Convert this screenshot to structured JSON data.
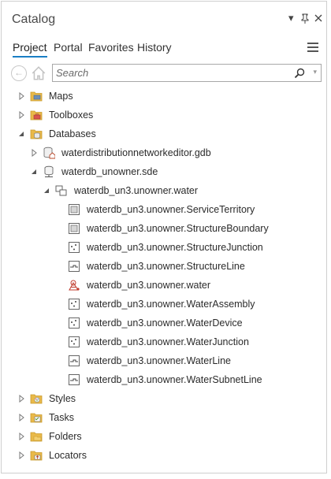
{
  "pane": {
    "title": "Catalog",
    "controls": {
      "options": "▾",
      "pin": "📌",
      "close": "✕"
    }
  },
  "tabs": [
    {
      "label": "Project",
      "active": true
    },
    {
      "label": "Portal",
      "active": false
    },
    {
      "label": "Favorites",
      "active": false
    },
    {
      "label": "History",
      "active": false
    }
  ],
  "search": {
    "placeholder": "Search",
    "value": ""
  },
  "tree": [
    {
      "label": "Maps",
      "icon": "maps-folder-icon",
      "expanded": false
    },
    {
      "label": "Toolboxes",
      "icon": "toolboxes-folder-icon",
      "expanded": false
    },
    {
      "label": "Databases",
      "icon": "databases-folder-icon",
      "expanded": true
    },
    {
      "label": "waterdistributionnetworkeditor.gdb",
      "icon": "geodatabase-home-icon",
      "expanded": false
    },
    {
      "label": "waterdb_unowner.sde",
      "icon": "database-connection-icon",
      "expanded": true
    },
    {
      "label": "waterdb_un3.unowner.water",
      "icon": "feature-dataset-icon",
      "expanded": true
    },
    {
      "label": "waterdb_un3.unowner.ServiceTerritory",
      "icon": "polygon-feature-class-icon"
    },
    {
      "label": "waterdb_un3.unowner.StructureBoundary",
      "icon": "polygon-feature-class-icon"
    },
    {
      "label": "waterdb_un3.unowner.StructureJunction",
      "icon": "point-feature-class-icon"
    },
    {
      "label": "waterdb_un3.unowner.StructureLine",
      "icon": "line-feature-class-icon"
    },
    {
      "label": "waterdb_un3.unowner.water",
      "icon": "utility-network-icon"
    },
    {
      "label": "waterdb_un3.unowner.WaterAssembly",
      "icon": "point-feature-class-icon"
    },
    {
      "label": "waterdb_un3.unowner.WaterDevice",
      "icon": "point-feature-class-icon"
    },
    {
      "label": "waterdb_un3.unowner.WaterJunction",
      "icon": "point-feature-class-icon"
    },
    {
      "label": "waterdb_un3.unowner.WaterLine",
      "icon": "line-feature-class-icon"
    },
    {
      "label": "waterdb_un3.unowner.WaterSubnetLine",
      "icon": "line-feature-class-icon"
    },
    {
      "label": "Styles",
      "icon": "styles-folder-icon",
      "expanded": false
    },
    {
      "label": "Tasks",
      "icon": "tasks-folder-icon",
      "expanded": false
    },
    {
      "label": "Folders",
      "icon": "folders-folder-icon",
      "expanded": false
    },
    {
      "label": "Locators",
      "icon": "locators-folder-icon",
      "expanded": false
    }
  ],
  "colors": {
    "accent": "#1a7ec4",
    "folder": "#e9b949",
    "folder_dark": "#c99a2e",
    "utility": "#c0392b"
  }
}
